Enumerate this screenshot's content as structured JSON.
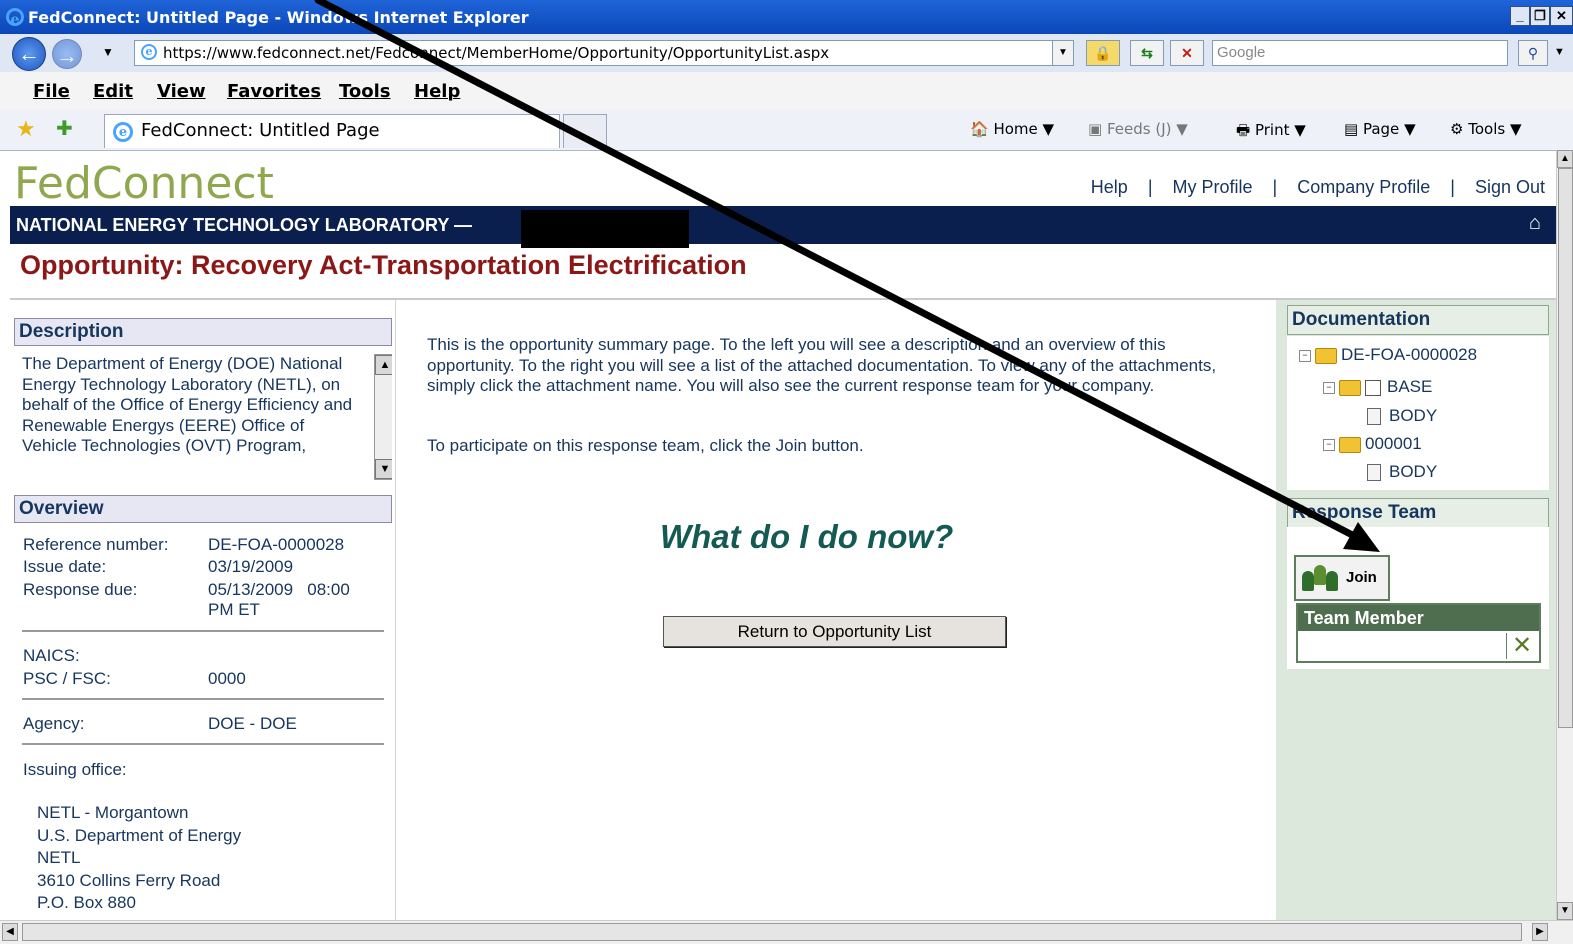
{
  "window": {
    "title": "FedConnect: Untitled Page - Windows Internet Explorer"
  },
  "address_bar": {
    "url": "https://www.fedconnect.net/Fedconnect/MemberHome/Opportunity/OpportunityList.aspx",
    "search_placeholder": "Google"
  },
  "menu": [
    "File",
    "Edit",
    "View",
    "Favorites",
    "Tools",
    "Help"
  ],
  "tab": {
    "title": "FedConnect: Untitled Page"
  },
  "command_bar": {
    "home": "Home",
    "feeds": "Feeds (J)",
    "print": "Print",
    "page": "Page",
    "tools": "Tools"
  },
  "site": {
    "logo": "FedConnect",
    "links": [
      "Help",
      "My Profile",
      "Company Profile",
      "Sign Out"
    ],
    "agency": "NATIONAL ENERGY TECHNOLOGY LABORATORY —",
    "page_title": "Opportunity: Recovery Act-Transportation Electrification"
  },
  "description": {
    "header": "Description",
    "text": "The Department of Energy (DOE) National Energy Technology Laboratory (NETL), on behalf of the Office of Energy Efficiency and Renewable Energys (EERE) Office of Vehicle Technologies (OVT) Program,"
  },
  "overview": {
    "header": "Overview",
    "reference_label": "Reference number:",
    "reference_value": "DE-FOA-0000028",
    "issue_label": "Issue date:",
    "issue_value": "03/19/2009",
    "due_label": "Response due:",
    "due_value_1": "05/13/2009   08:00",
    "due_value_2": "PM ET",
    "naics_label": "NAICS:",
    "psc_label": "PSC / FSC:",
    "psc_value": "0000",
    "agency_label": "Agency:",
    "agency_value": "DOE - DOE",
    "office_label": "Issuing office:",
    "office_lines": [
      "NETL - Morgantown",
      "U.S. Department of Energy",
      "NETL",
      "3610 Collins Ferry Road",
      "P.O. Box 880"
    ]
  },
  "center": {
    "intro": "This is the opportunity summary page. To the left you will see a description and an overview of this opportunity. To the right you will see a list of the attached documentation. To view any of the attachments, simply click the attachment name. You will also see the current response team for your company.",
    "join_hint": "To participate on this response team, click the Join button.",
    "heading": "What do I do now?",
    "return_button": "Return to Opportunity List"
  },
  "documentation": {
    "header": "Documentation",
    "root": "DE-FOA-0000028",
    "nodes": [
      {
        "name": "BASE",
        "child": "BODY"
      },
      {
        "name": "000001",
        "child": "BODY"
      }
    ]
  },
  "response_team": {
    "header": "Response Team",
    "join_label": "Join",
    "column": "Team Member"
  },
  "colors": {
    "agency_bar": "#0b1f4f",
    "title_red": "#8c1717",
    "heading_teal": "#145a52",
    "logo_green": "#8fa74e"
  },
  "icons": [
    "ie-icon",
    "back-arrow-icon",
    "forward-arrow-icon",
    "lock-icon",
    "refresh-icon",
    "stop-icon",
    "search-icon",
    "star-icon",
    "add-favorite-icon",
    "home-icon",
    "feeds-icon",
    "print-icon",
    "page-icon",
    "tools-icon",
    "folder-icon",
    "document-icon",
    "team-icon",
    "remove-x-icon"
  ]
}
